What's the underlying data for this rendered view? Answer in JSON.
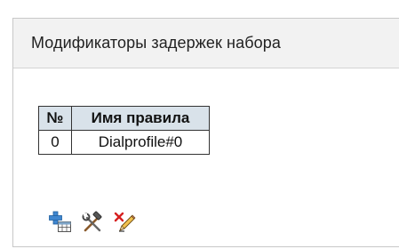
{
  "panel": {
    "title": "Модификаторы задержек набора"
  },
  "table": {
    "headers": [
      "№",
      "Имя правила"
    ],
    "rows": [
      [
        "0",
        "Dialprofile#0"
      ]
    ]
  },
  "toolbar": {
    "icons": [
      "add-icon",
      "edit-tools-icon",
      "delete-icon"
    ]
  },
  "colors": {
    "header_bg": "#f2f2f2",
    "table_header_bg": "#d9e2ea",
    "border": "#333333"
  }
}
